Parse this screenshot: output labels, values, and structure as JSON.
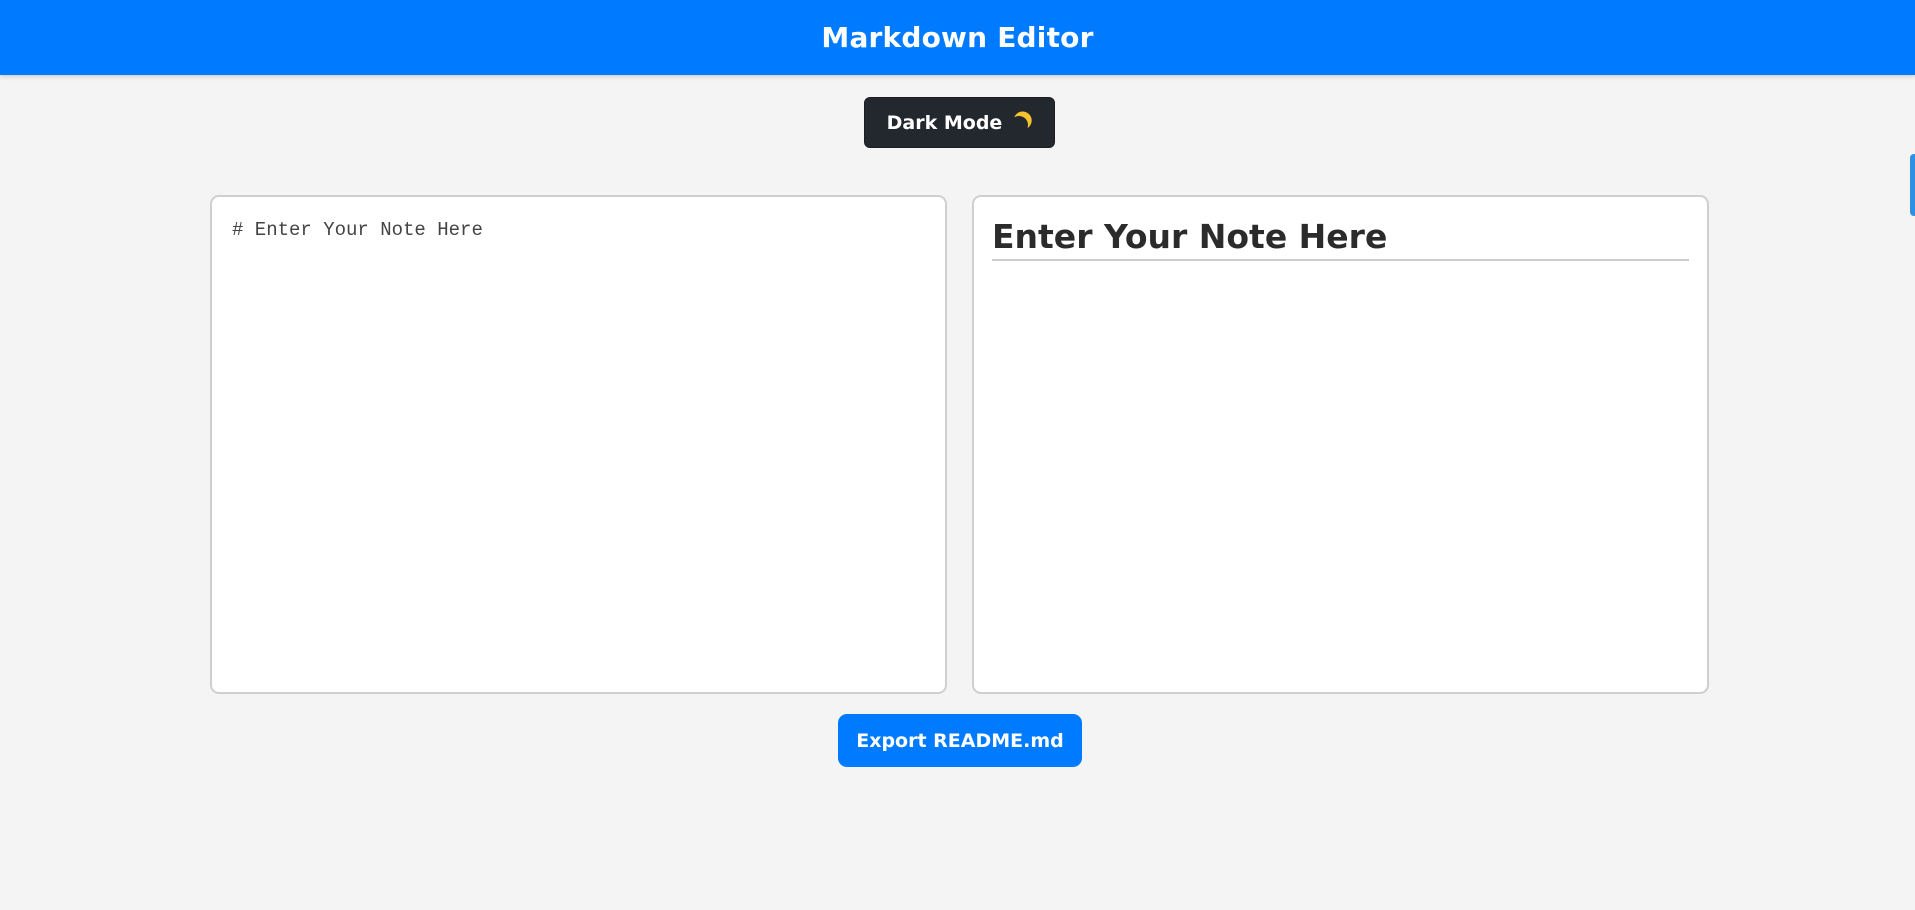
{
  "header": {
    "title": "Markdown Editor"
  },
  "toolbar": {
    "dark_mode_label": "Dark Mode",
    "dark_mode_icon": "moon-icon"
  },
  "editor": {
    "value": "# Enter Your Note Here"
  },
  "preview": {
    "heading": "Enter Your Note Here"
  },
  "actions": {
    "export_label": "Export README.md"
  },
  "colors": {
    "header_bg": "#007bff",
    "page_bg": "#f4f4f4",
    "dark_button_bg": "#23272e",
    "moon": "#f4c430",
    "export_button_bg": "#007bff"
  }
}
